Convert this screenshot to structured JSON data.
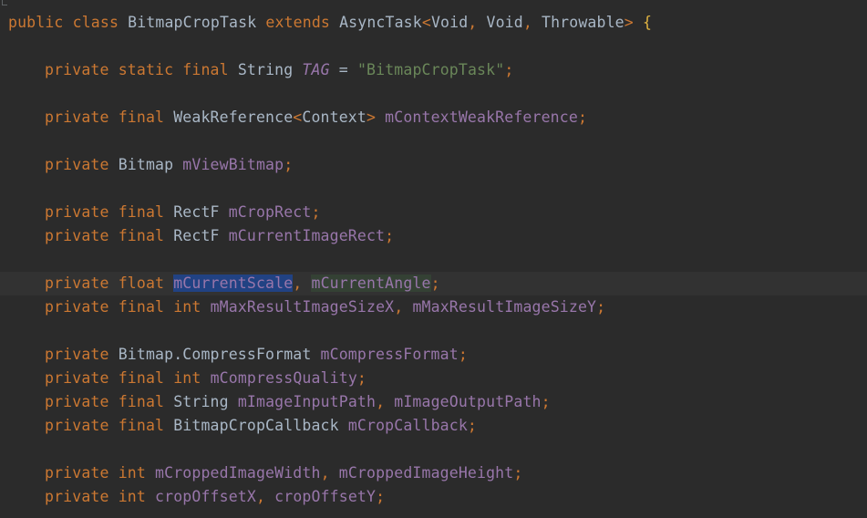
{
  "editor": {
    "line1": {
      "kw1": "public",
      "kw2": "class",
      "name": "BitmapCropTask",
      "kw3": "extends",
      "type": "AsyncTask",
      "lt": "<",
      "t1": "Void",
      "c1": ",",
      "t2": "Void",
      "c2": ",",
      "t3": "Throwable",
      "gt": ">",
      "brace": "{"
    },
    "line2": {
      "kw1": "private",
      "kw2": "static",
      "kw3": "final",
      "type": "String",
      "field": "TAG",
      "eq": "=",
      "value": "\"BitmapCropTask\"",
      "semi": ";"
    },
    "line3": {
      "kw1": "private",
      "kw2": "final",
      "type": "WeakReference",
      "lt": "<",
      "gen": "Context",
      "gt": ">",
      "field": "mContextWeakReference",
      "semi": ";"
    },
    "line4": {
      "kw1": "private",
      "type": "Bitmap",
      "field": "mViewBitmap",
      "semi": ";"
    },
    "line5": {
      "kw1": "private",
      "kw2": "final",
      "type": "RectF",
      "field": "mCropRect",
      "semi": ";"
    },
    "line6": {
      "kw1": "private",
      "kw2": "final",
      "type": "RectF",
      "field": "mCurrentImageRect",
      "semi": ";"
    },
    "line7": {
      "kw1": "private",
      "kw2": "float",
      "field1": "mCurrentScale",
      "comma": ",",
      "field2": "mCurrentAngle",
      "semi": ";"
    },
    "line8": {
      "kw1": "private",
      "kw2": "final",
      "kw3": "int",
      "field1": "mMaxResultImageSizeX",
      "comma": ",",
      "field2": "mMaxResultImageSizeY",
      "semi": ";"
    },
    "line9": {
      "kw1": "private",
      "type": "Bitmap.CompressFormat",
      "field": "mCompressFormat",
      "semi": ";"
    },
    "line10": {
      "kw1": "private",
      "kw2": "final",
      "kw3": "int",
      "field": "mCompressQuality",
      "semi": ";"
    },
    "line11": {
      "kw1": "private",
      "kw2": "final",
      "type": "String",
      "field1": "mImageInputPath",
      "comma": ",",
      "field2": "mImageOutputPath",
      "semi": ";"
    },
    "line12": {
      "kw1": "private",
      "kw2": "final",
      "type": "BitmapCropCallback",
      "field": "mCropCallback",
      "semi": ";"
    },
    "line13": {
      "kw1": "private",
      "kw2": "int",
      "field1": "mCroppedImageWidth",
      "comma": ",",
      "field2": "mCroppedImageHeight",
      "semi": ";"
    },
    "line14": {
      "kw1": "private",
      "kw2": "int",
      "field1": "cropOffsetX",
      "comma": ",",
      "field2": "cropOffsetY",
      "semi": ";"
    }
  },
  "colors": {
    "background": "#2b2b2b",
    "current_line": "#323232",
    "keyword": "#cc7832",
    "field": "#9876aa",
    "string": "#6a8759",
    "text": "#a9b7c6",
    "selection": "#214283",
    "read_highlight": "#344134"
  }
}
